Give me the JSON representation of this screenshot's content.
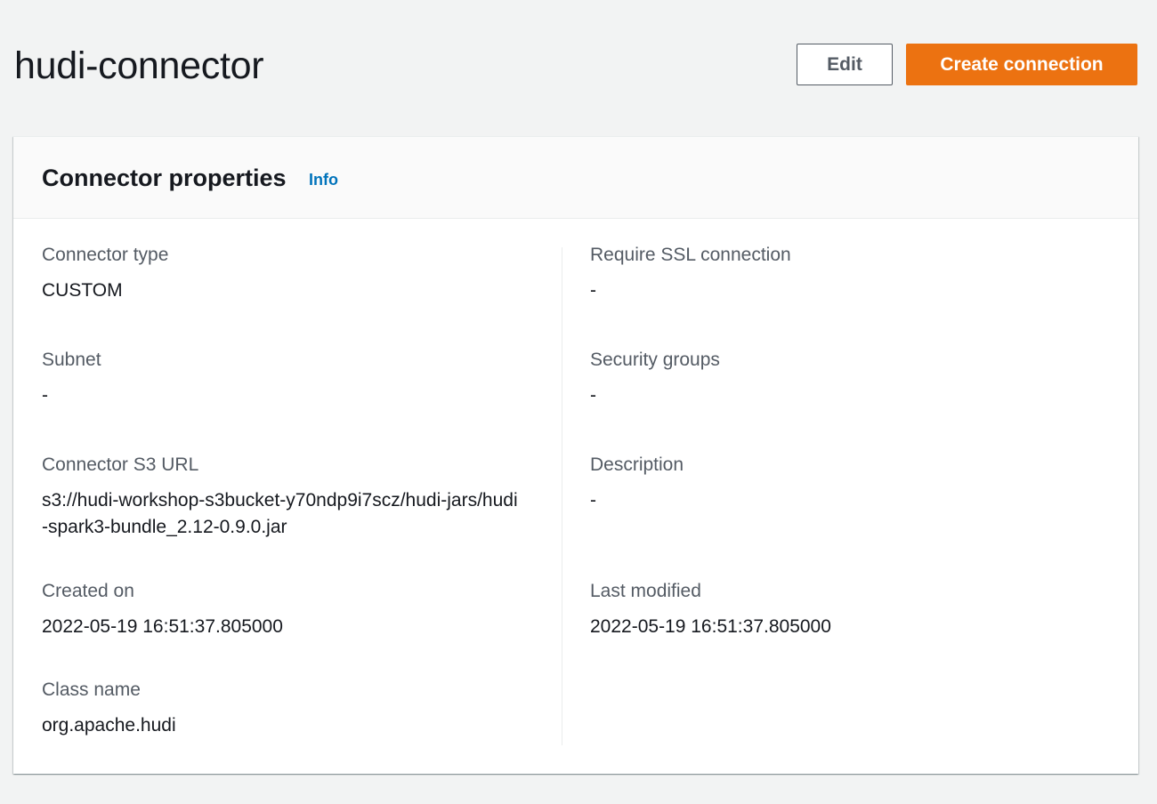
{
  "header": {
    "title": "hudi-connector",
    "edit_label": "Edit",
    "create_label": "Create connection"
  },
  "panel": {
    "title": "Connector properties",
    "info_label": "Info",
    "left_fields": [
      {
        "label": "Connector type",
        "value": "CUSTOM"
      },
      {
        "label": "Subnet",
        "value": "-"
      },
      {
        "label": "Connector S3 URL",
        "value": "s3://hudi-workshop-s3bucket-y70ndp9i7scz/hudi-jars/hudi-spark3-bundle_2.12-0.9.0.jar"
      },
      {
        "label": "Created on",
        "value": "2022-05-19 16:51:37.805000"
      },
      {
        "label": "Class name",
        "value": "org.apache.hudi"
      }
    ],
    "right_fields": [
      {
        "label": "Require SSL connection",
        "value": "-"
      },
      {
        "label": "Security groups",
        "value": "-"
      },
      {
        "label": "Description",
        "value": "-"
      },
      {
        "label": "Last modified",
        "value": "2022-05-19 16:51:37.805000"
      }
    ]
  },
  "colors": {
    "accent": "#ec7211",
    "link": "#0073bb",
    "background": "#f2f3f3"
  }
}
